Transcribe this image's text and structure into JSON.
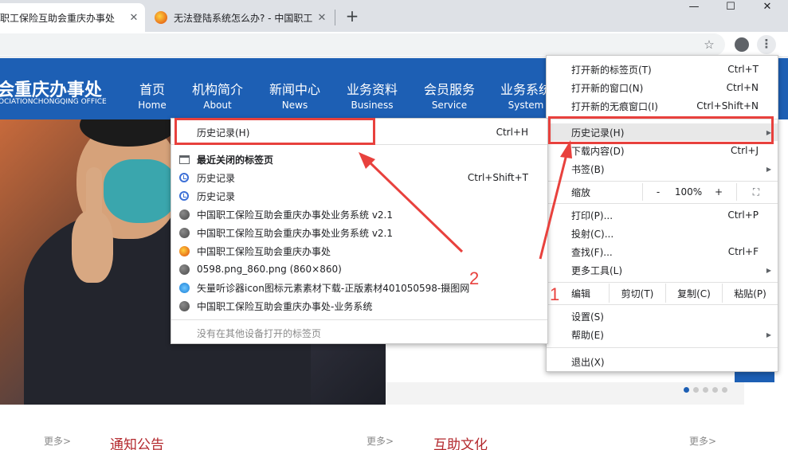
{
  "browser": {
    "tabs": [
      {
        "title": "职工保险互助会重庆办事处",
        "close": "✕"
      },
      {
        "title": "无法登陆系统怎么办? - 中国职工",
        "close": "✕"
      }
    ],
    "new_tab": "+",
    "window_controls": {
      "minimize": "—",
      "maximize": "☐",
      "close": "✕"
    },
    "toolbar": {
      "bookmark_star": "☆",
      "menu": "⋮"
    }
  },
  "site": {
    "logo": "会重庆办事处",
    "logo_sub": "OCIATIONCHONGQING OFFICE",
    "nav": [
      {
        "cn": "首页",
        "en": "Home"
      },
      {
        "cn": "机构简介",
        "en": "About"
      },
      {
        "cn": "新闻中心",
        "en": "News"
      },
      {
        "cn": "业务资料",
        "en": "Business"
      },
      {
        "cn": "会员服务",
        "en": "Service"
      },
      {
        "cn": "业务系统",
        "en": "System"
      }
    ],
    "sections": [
      {
        "more": "更多>",
        "title": "通知公告"
      },
      {
        "more": "更多>",
        "title": "互助文化"
      },
      {
        "more": "更多>"
      }
    ],
    "accent_color": "#1d5fb4"
  },
  "chrome_menu": {
    "new_tab": {
      "label": "打开新的标签页(T)",
      "shortcut": "Ctrl+T"
    },
    "new_window": {
      "label": "打开新的窗口(N)",
      "shortcut": "Ctrl+N"
    },
    "incognito": {
      "label": "打开新的无痕窗口(I)",
      "shortcut": "Ctrl+Shift+N"
    },
    "history": {
      "label": "历史记录(H)"
    },
    "downloads": {
      "label": "下载内容(D)",
      "shortcut": "Ctrl+J"
    },
    "bookmarks": {
      "label": "书签(B)"
    },
    "zoom": {
      "label": "缩放",
      "minus": "-",
      "value": "100%",
      "plus": "+",
      "fullscreen": "⛶"
    },
    "print": {
      "label": "打印(P)...",
      "shortcut": "Ctrl+P"
    },
    "cast": {
      "label": "投射(C)..."
    },
    "find": {
      "label": "查找(F)...",
      "shortcut": "Ctrl+F"
    },
    "more_tools": {
      "label": "更多工具(L)"
    },
    "edit": {
      "label": "编辑",
      "cut": "剪切(T)",
      "copy": "复制(C)",
      "paste": "粘贴(P)"
    },
    "settings": {
      "label": "设置(S)"
    },
    "help": {
      "label": "帮助(E)"
    },
    "exit": {
      "label": "退出(X)"
    }
  },
  "history_menu": {
    "header": {
      "label": "历史记录(H)",
      "shortcut": "Ctrl+H"
    },
    "recently_closed": "最近关闭的标签页",
    "items": [
      {
        "label": "历史记录",
        "shortcut": "Ctrl+Shift+T",
        "icon": "history-icon"
      },
      {
        "label": "历史记录",
        "shortcut": "",
        "icon": "history-icon"
      },
      {
        "label": "中国职工保险互助会重庆办事处业务系统 v2.1",
        "icon": "globe-icon"
      },
      {
        "label": "中国职工保险互助会重庆办事处业务系统 v2.1",
        "icon": "globe-icon"
      },
      {
        "label": "中国职工保险互助会重庆办事处",
        "icon": "site-favicon-icon"
      },
      {
        "label": "0598.png_860.png (860×860)",
        "icon": "globe-icon"
      },
      {
        "label": "矢量听诊器icon图标元素素材下载-正版素材401050598-摄图网",
        "icon": "sheji-favicon-icon"
      },
      {
        "label": "中国职工保险互助会重庆办事处-业务系统",
        "icon": "globe-icon"
      }
    ],
    "no_other_devices": "没有在其他设备打开的标签页"
  },
  "annotations": {
    "step1": "1",
    "step2": "2",
    "color": "#e8413d"
  }
}
